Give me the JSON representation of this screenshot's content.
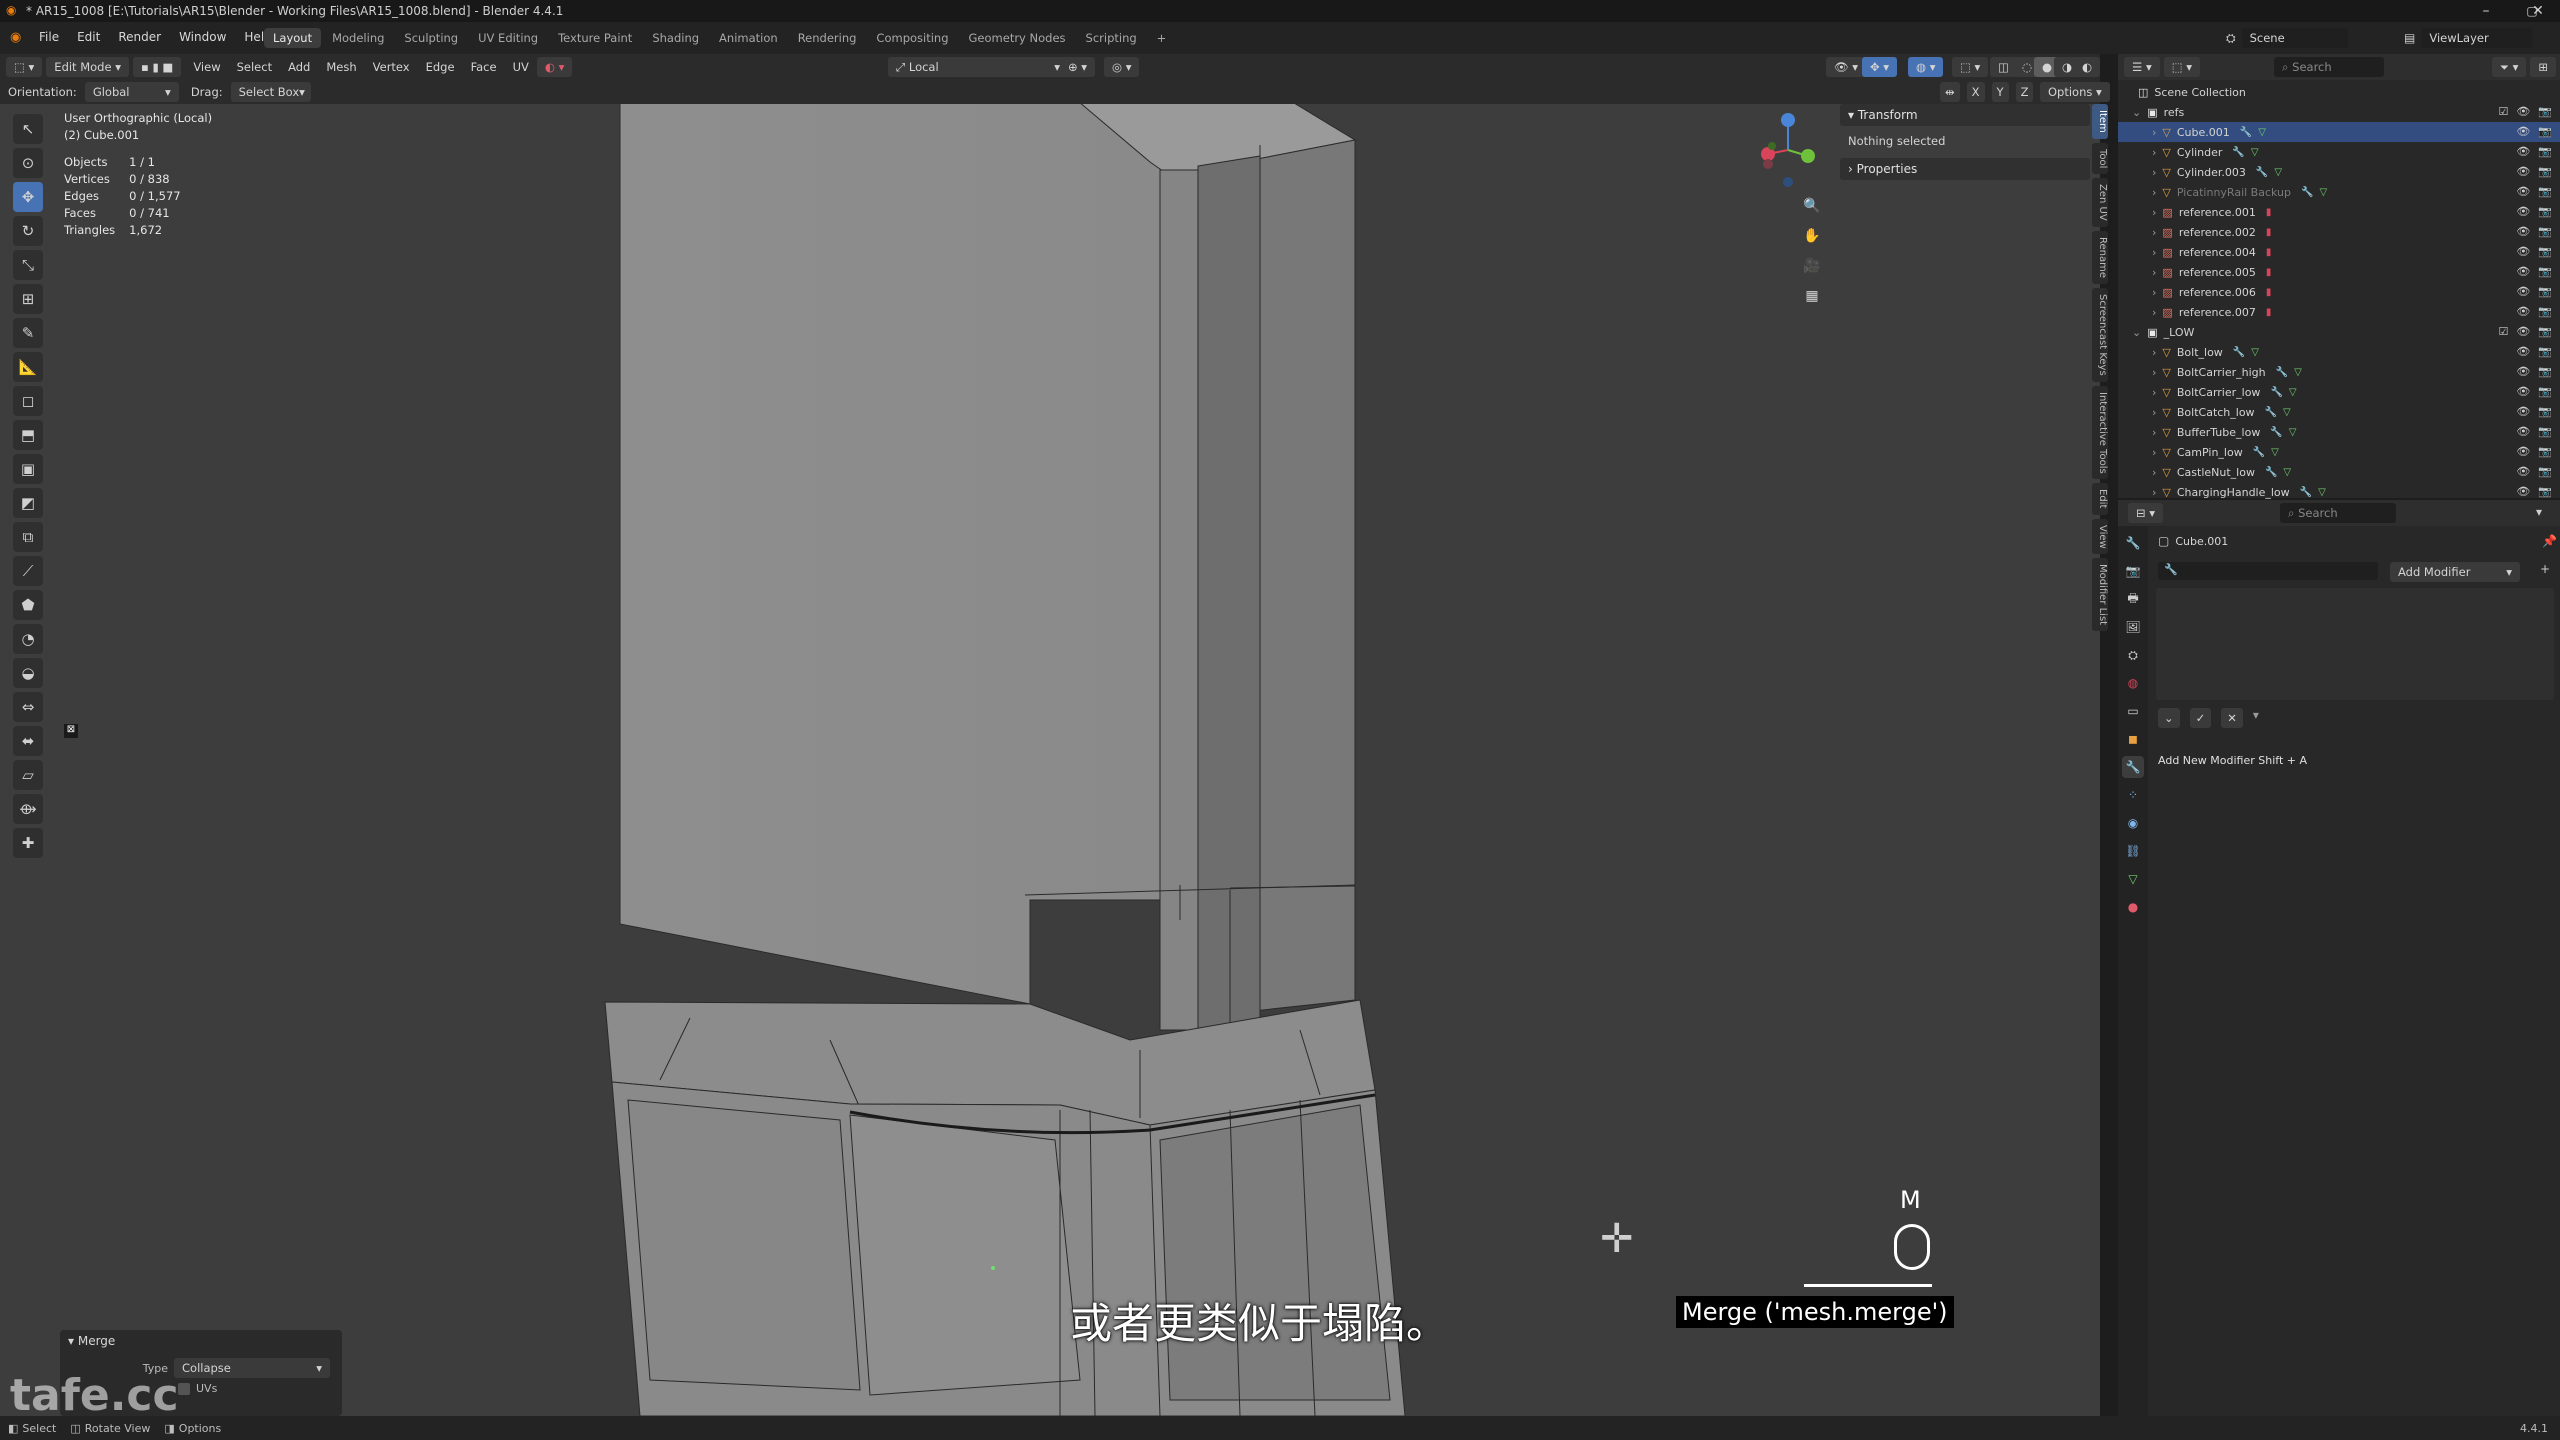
{
  "window": {
    "title": "* AR15_1008 [E:\\Tutorials\\AR15\\Blender - Working Files\\AR15_1008.blend] - Blender 4.4.1",
    "minimize": "–",
    "maximize": "▢",
    "close": "✕"
  },
  "menu": {
    "items": [
      "File",
      "Edit",
      "Render",
      "Window",
      "Help"
    ],
    "workspaces": [
      "Layout",
      "Modeling",
      "Sculpting",
      "UV Editing",
      "Texture Paint",
      "Shading",
      "Animation",
      "Rendering",
      "Compositing",
      "Geometry Nodes",
      "Scripting"
    ],
    "add_workspace": "+",
    "scene_label": "Scene",
    "viewlayer_label": "ViewLayer"
  },
  "viewport_header": {
    "mode": "Edit Mode",
    "menus": [
      "View",
      "Select",
      "Add",
      "Mesh",
      "Vertex",
      "Edge",
      "Face",
      "UV"
    ],
    "pivot": "Local",
    "options": "Options",
    "orientation_label": "Orientation:",
    "orientation_value": "Global",
    "drag_label": "Drag:",
    "drag_value": "Select Box",
    "axes": [
      "X",
      "Y",
      "Z"
    ]
  },
  "stats": {
    "view_name": "User Orthographic (Local)",
    "object_name": "(2) Cube.001",
    "rows": [
      {
        "label": "Objects",
        "value": "1 / 1"
      },
      {
        "label": "Vertices",
        "value": "0 / 838"
      },
      {
        "label": "Edges",
        "value": "0 / 1,577"
      },
      {
        "label": "Faces",
        "value": "0 / 741"
      },
      {
        "label": "Triangles",
        "value": "1,672"
      }
    ]
  },
  "npanel": {
    "transform_label": "Transform",
    "nothing_selected": "Nothing selected",
    "properties_label": "Properties",
    "tabs": [
      "Item",
      "Tool",
      "Zen UV",
      "Rename",
      "Screencast Keys",
      "Interactive Tools",
      "Edit",
      "View",
      "Modifier List"
    ]
  },
  "outliner": {
    "search_placeholder": "Search",
    "root": "Scene Collection",
    "rows": [
      {
        "name": "refs",
        "kind": "collection",
        "depth": 1,
        "selected": false,
        "dim": false
      },
      {
        "name": "Cube.001",
        "kind": "object",
        "depth": 2,
        "selected": true,
        "dim": false
      },
      {
        "name": "Cylinder",
        "kind": "object",
        "depth": 2,
        "selected": false,
        "dim": false
      },
      {
        "name": "Cylinder.003",
        "kind": "object",
        "depth": 2,
        "selected": false,
        "dim": false
      },
      {
        "name": "PicatinnyRail Backup",
        "kind": "object",
        "depth": 2,
        "selected": false,
        "dim": true
      },
      {
        "name": "reference.001",
        "kind": "image",
        "depth": 2,
        "selected": false,
        "dim": false
      },
      {
        "name": "reference.002",
        "kind": "image",
        "depth": 2,
        "selected": false,
        "dim": false
      },
      {
        "name": "reference.004",
        "kind": "image",
        "depth": 2,
        "selected": false,
        "dim": false
      },
      {
        "name": "reference.005",
        "kind": "image",
        "depth": 2,
        "selected": false,
        "dim": false
      },
      {
        "name": "reference.006",
        "kind": "image",
        "depth": 2,
        "selected": false,
        "dim": false
      },
      {
        "name": "reference.007",
        "kind": "image",
        "depth": 2,
        "selected": false,
        "dim": false
      },
      {
        "name": "_LOW",
        "kind": "collection",
        "depth": 1,
        "selected": false,
        "dim": false
      },
      {
        "name": "Bolt_low",
        "kind": "object",
        "depth": 2,
        "selected": false,
        "dim": false
      },
      {
        "name": "BoltCarrier_high",
        "kind": "object",
        "depth": 2,
        "selected": false,
        "dim": false
      },
      {
        "name": "BoltCarrier_low",
        "kind": "object",
        "depth": 2,
        "selected": false,
        "dim": false
      },
      {
        "name": "BoltCatch_low",
        "kind": "object",
        "depth": 2,
        "selected": false,
        "dim": false
      },
      {
        "name": "BufferTube_low",
        "kind": "object",
        "depth": 2,
        "selected": false,
        "dim": false
      },
      {
        "name": "CamPin_low",
        "kind": "object",
        "depth": 2,
        "selected": false,
        "dim": false
      },
      {
        "name": "CastleNut_low",
        "kind": "object",
        "depth": 2,
        "selected": false,
        "dim": false
      },
      {
        "name": "ChargingHandle_low",
        "kind": "object",
        "depth": 2,
        "selected": false,
        "dim": false
      }
    ]
  },
  "properties": {
    "search_placeholder": "Search",
    "object_name": "Cube.001",
    "add_modifier": "Add Modifier",
    "add_modifier_hint": "Add New Modifier  Shift + A"
  },
  "merge_panel": {
    "title": "Merge",
    "type_label": "Type",
    "type_value": "Collapse",
    "uvs_label": "UVs"
  },
  "overlay": {
    "subtitle": "或者更类似于塌陷。",
    "key_hint": "Merge ('mesh.merge')",
    "key_pressed": "M"
  },
  "watermark": "tafe.cc",
  "statusbar": {
    "select": "Select",
    "rotate": "Rotate View",
    "options": "Options",
    "version": "4.4.1"
  },
  "colors": {
    "accent": "#4772b3",
    "selection": "#334d80",
    "viewport_bg": "#3d3d3d"
  }
}
